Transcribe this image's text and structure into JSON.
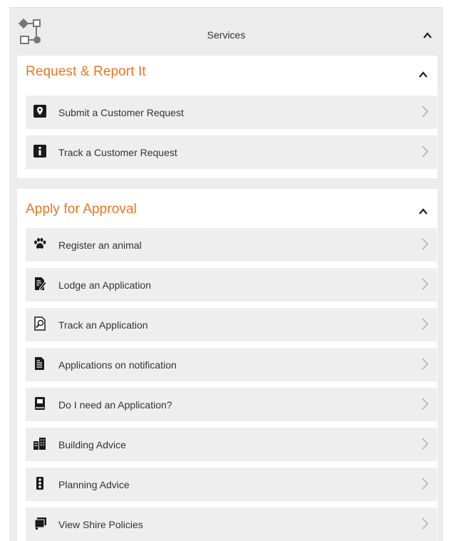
{
  "header": {
    "title": "Services",
    "icon": "sitemap-icon"
  },
  "sections": [
    {
      "title": "Request & Report It",
      "expanded": true,
      "items": [
        {
          "label": "Submit a Customer Request",
          "icon": "map-marker-icon"
        },
        {
          "label": "Track a Customer Request",
          "icon": "info-icon"
        }
      ]
    },
    {
      "title": "Apply for Approval",
      "expanded": true,
      "items": [
        {
          "label": "Register an animal",
          "icon": "paw-icon"
        },
        {
          "label": "Lodge an Application",
          "icon": "edit-document-icon"
        },
        {
          "label": "Track an Application",
          "icon": "search-document-icon"
        },
        {
          "label": "Applications on notification",
          "icon": "document-list-icon"
        },
        {
          "label": "Do I need an Application?",
          "icon": "book-icon"
        },
        {
          "label": "Building Advice",
          "icon": "building-icon"
        },
        {
          "label": "Planning Advice",
          "icon": "traffic-light-icon"
        },
        {
          "label": "View Shire Policies",
          "icon": "documents-stack-icon"
        }
      ]
    }
  ],
  "colors": {
    "accent": "#e87722",
    "panel": "#ececec",
    "item": "#eeeeee",
    "text": "#333333"
  }
}
